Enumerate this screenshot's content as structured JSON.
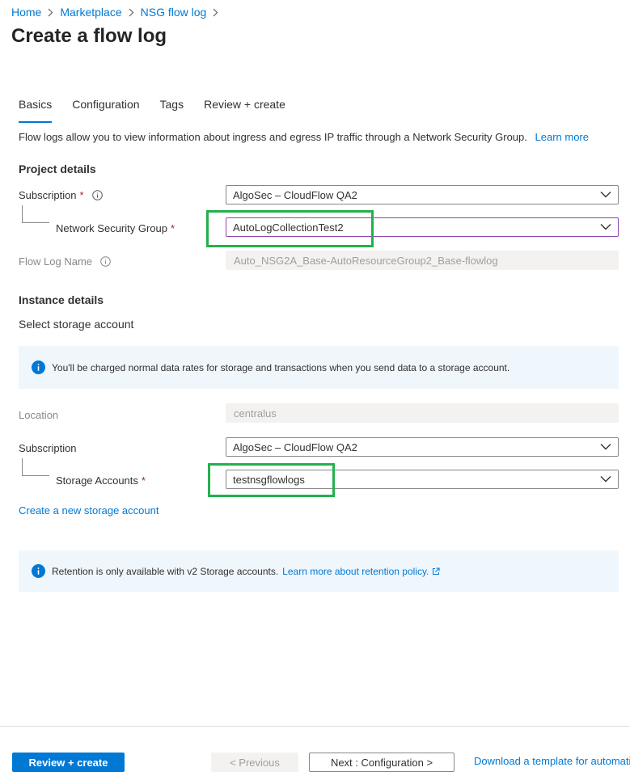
{
  "breadcrumb": {
    "items": [
      "Home",
      "Marketplace",
      "NSG flow log"
    ]
  },
  "page": {
    "title": "Create a flow log"
  },
  "tabs": [
    "Basics",
    "Configuration",
    "Tags",
    "Review + create"
  ],
  "intro": {
    "text": "Flow logs allow you to view information about ingress and egress IP traffic through a Network Security Group.",
    "learn_more": "Learn more"
  },
  "project_details": {
    "heading": "Project details",
    "subscription_label": "Subscription",
    "subscription_value": "AlgoSec – CloudFlow QA2",
    "nsg_label": "Network Security Group",
    "nsg_value": "AutoLogCollectionTest2",
    "flow_log_name_label": "Flow Log Name",
    "flow_log_name_value": "Auto_NSG2A_Base-AutoResourceGroup2_Base-flowlog"
  },
  "instance_details": {
    "heading": "Instance details",
    "select_storage": "Select storage account",
    "charge_notice": "You'll be charged normal data rates for storage and transactions when you send data to a storage account.",
    "location_label": "Location",
    "location_value": "centralus",
    "subscription_label": "Subscription",
    "subscription_value": "AlgoSec – CloudFlow QA2",
    "storage_label": "Storage Accounts",
    "storage_value": "testnsgflowlogs",
    "create_storage_link": "Create a new storage account",
    "retention_notice": "Retention is only available with v2 Storage accounts.",
    "retention_link": "Learn more about retention policy."
  },
  "footer": {
    "review_create": "Review + create",
    "previous": "< Previous",
    "next": "Next : Configuration >",
    "download_template": "Download a template for automation"
  },
  "colors": {
    "accent": "#0078d4",
    "required": "#a4262c",
    "highlight": "#22b14c",
    "banner_bg": "#eff6fc"
  }
}
